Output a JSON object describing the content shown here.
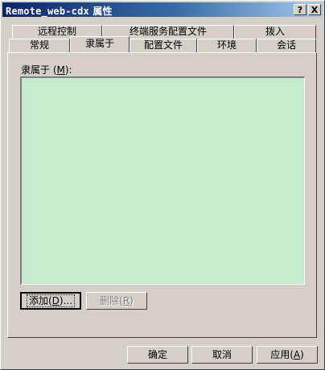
{
  "window": {
    "title_name": "Remote_web-cdx",
    "title_suffix": "属性",
    "help_button": "?",
    "close_button": "X"
  },
  "tabs_row1": [
    {
      "label": "远程控制"
    },
    {
      "label": "终端服务配置文件"
    },
    {
      "label": "拨入"
    }
  ],
  "tabs_row2": [
    {
      "label": "常规"
    },
    {
      "label": "隶属于"
    },
    {
      "label": "配置文件"
    },
    {
      "label": "环境"
    },
    {
      "label": "会话"
    }
  ],
  "panel": {
    "member_label": "隶属于",
    "member_mnemonic": "M",
    "member_list_items": [],
    "add_button_text": "添加",
    "add_button_mnemonic": "D",
    "remove_button_text": "删除",
    "remove_button_mnemonic": "R"
  },
  "footer": {
    "ok_label": "确定",
    "cancel_label": "取消",
    "apply_label": "应用",
    "apply_mnemonic": "A"
  },
  "colors": {
    "title_gradient_start": "#0a246a",
    "title_gradient_end": "#a6caf0",
    "face": "#d4d0c8",
    "listbox_bg": "#c7ebcf"
  }
}
